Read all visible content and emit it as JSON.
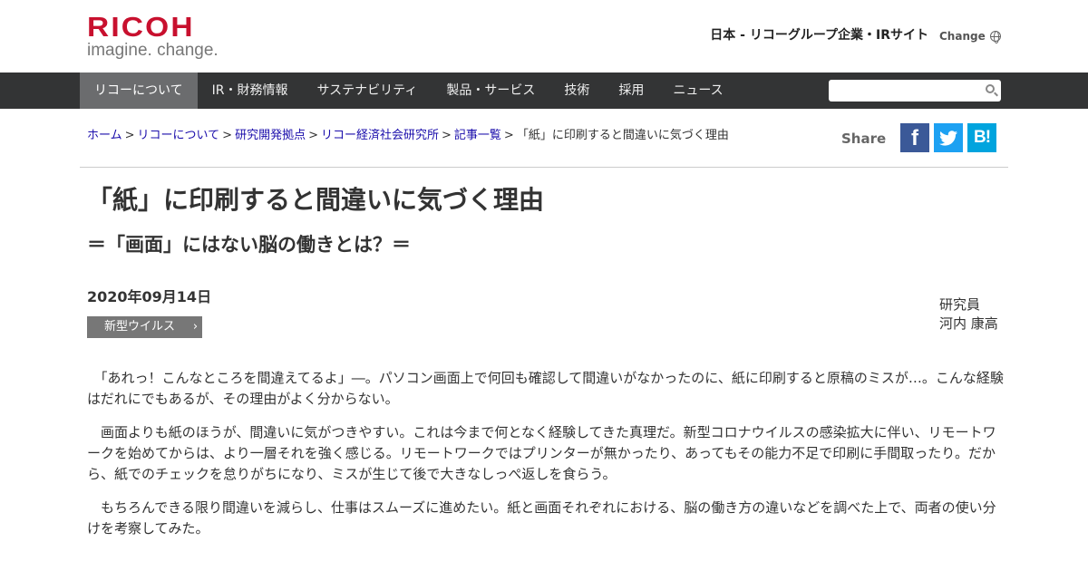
{
  "logo": {
    "word": "RICOH",
    "tagline": "imagine. change."
  },
  "header": {
    "site_name": "日本 - リコーグループ企業・IRサイト",
    "change_label": "Change"
  },
  "nav": {
    "items": [
      "リコーについて",
      "IR・財務情報",
      "サステナビリティ",
      "製品・サービス",
      "技術",
      "採用",
      "ニュース"
    ],
    "active_index": 0
  },
  "search": {
    "placeholder": ""
  },
  "breadcrumb": {
    "links": [
      "ホーム",
      "リコーについて",
      "研究開発拠点",
      "リコー経済社会研究所",
      "記事一覧"
    ],
    "current": "「紙」に印刷すると間違いに気づく理由",
    "separator": ">"
  },
  "share": {
    "label": "Share",
    "buttons": [
      "facebook-icon",
      "twitter-icon",
      "hatena-bookmark-icon"
    ],
    "hatena_label": "B!",
    "colors": {
      "facebook": "#3b5998",
      "twitter": "#1da1f2",
      "hatena": "#00a4de"
    }
  },
  "article": {
    "title": "「紙」に印刷すると間違いに気づく理由",
    "subtitle": "＝「画面」にはない脳の働きとは？＝",
    "date": "2020年09月14日",
    "tag": "新型ウイルス",
    "author_role": "研究員",
    "author_name": "河内 康高",
    "paragraphs": [
      "　「あれっ！こんなところを間違えてるよ」―。パソコン画面上で何回も確認して間違いがなかったのに、紙に印刷すると原稿のミスが…。こんな経験はだれにでもあるが、その理由がよく分からない。",
      "　画面よりも紙のほうが、間違いに気がつきやすい。これは今まで何となく経験してきた真理だ。新型コロナウイルスの感染拡大に伴い、リモートワークを始めてからは、より一層それを強く感じる。リモートワークではプリンターが無かったり、あってもその能力不足で印刷に手間取ったり。だから、紙でのチェックを怠りがちになり、ミスが生じて後で大きなしっぺ返しを食らう。",
      "　もちろんできる限り間違いを減らし、仕事はスムーズに進めたい。紙と画面それぞれにおける、脳の働き方の違いなどを調べた上で、両者の使い分けを考察してみた。"
    ]
  },
  "colors": {
    "brand": "#c8102e",
    "nav_bg": "#333435",
    "nav_active": "#6b6c6e",
    "link": "#1a0dab",
    "tag_bg": "#777777"
  }
}
